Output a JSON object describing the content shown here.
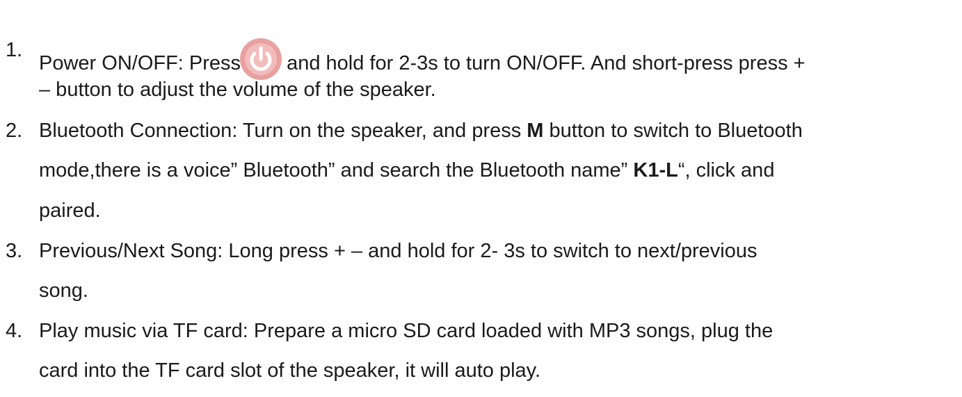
{
  "items": [
    {
      "number": "1.",
      "line1_a": "Power ON/OFF: Press",
      "power_icon": "power-button-icon",
      "line1_b": "and hold for 2-3s to turn ON/OFF. And short-press press +",
      "line2": "– button to adjust the volume of the speaker."
    },
    {
      "number": "2.",
      "line1_a": "Bluetooth Connection: Turn on the speaker, and press ",
      "line1_bold": "M",
      "line1_b": " button to switch to Bluetooth",
      "line2_a": "mode,there is a voice” Bluetooth” and search the Bluetooth name” ",
      "line2_bold": "K1-L",
      "line2_b": "“, click and",
      "line3": "paired."
    },
    {
      "number": "3.",
      "line1": "Previous/Next Song: Long press + – and hold for 2- 3s to switch to next/previous",
      "line2": "song."
    },
    {
      "number": "4.",
      "line1": "Play music via TF card: Prepare a micro SD card loaded with MP3 songs, plug the",
      "line2": "card into the TF card slot of the speaker, it will auto play."
    }
  ],
  "colors": {
    "text": "#1a1a1a",
    "power_icon_outer": "#e9a0a0",
    "power_icon_inner": "#f3bcbc",
    "power_icon_symbol": "#ffffff"
  }
}
